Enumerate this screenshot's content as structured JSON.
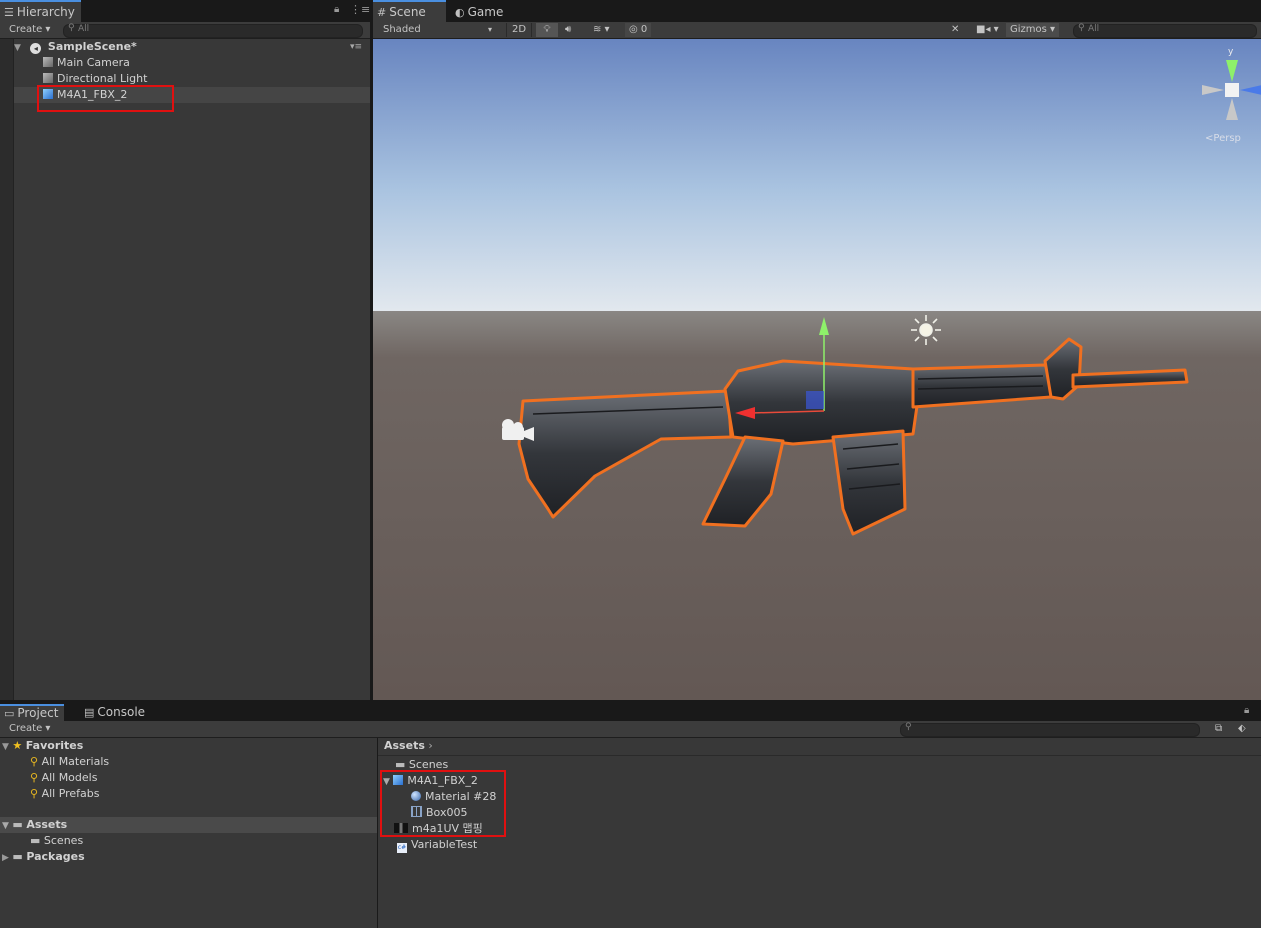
{
  "hierarchy": {
    "tab_label": "Hierarchy",
    "create_label": "Create",
    "search_placeholder": "All",
    "scene_name": "SampleScene*",
    "items": [
      "Main Camera",
      "Directional Light",
      "M4A1_FBX_2"
    ]
  },
  "scene": {
    "tab_scene": "Scene",
    "tab_game": "Game",
    "shading_mode": "Shaded",
    "btn_2d": "2D",
    "hidden_count": "0",
    "gizmos_label": "Gizmos",
    "search_placeholder": "All",
    "axis_y": "y",
    "persp_label": "Persp"
  },
  "project": {
    "tab_project": "Project",
    "tab_console": "Console",
    "create_label": "Create",
    "favorites_label": "Favorites",
    "favorites": [
      "All Materials",
      "All Models",
      "All Prefabs"
    ],
    "assets_label": "Assets",
    "assets_children": [
      "Scenes"
    ],
    "packages_label": "Packages",
    "breadcrumb": "Assets",
    "files": {
      "scenes": "Scenes",
      "model": "M4A1_FBX_2",
      "material": "Material #28",
      "mesh": "Box005",
      "texture": "m4a1UV 맵핑",
      "script": "VariableTest"
    }
  },
  "colors": {
    "selection_outline": "#f07020",
    "annotation_box": "#e01010",
    "tab_accent": "#4a8fe0",
    "sky_top": "#6a8cc4",
    "ground": "#655a56"
  }
}
